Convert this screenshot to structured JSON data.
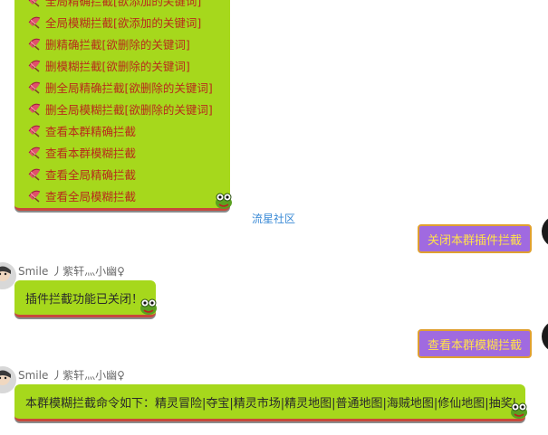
{
  "commands": [
    "全局精确拦截[欲添加的关键词]",
    "全局模糊拦截[欲添加的关键词]",
    "删精确拦截[欲删除的关键词]",
    "删模糊拦截[欲删除的关键词]",
    "删全局精确拦截[欲删除的关键词]",
    "删全局模糊拦截[欲删除的关键词]",
    "查看本群精确拦截",
    "查看本群模糊拦截",
    "查看全局精确拦截",
    "查看全局模糊拦截"
  ],
  "community_link": "流星社区",
  "outgoing": [
    {
      "text": "关闭本群插件拦截"
    },
    {
      "text": "查看本群模糊拦截"
    }
  ],
  "incoming": [
    {
      "sender": "Smile 丿紫轩灬小幽♀",
      "text": "插件拦截功能已关闭！"
    },
    {
      "sender": "Smile 丿紫轩灬小幽♀",
      "text": "本群模糊拦截命令如下：精灵冒险|夺宝|精灵市场|精灵地图|普通地图|海贼地图|修仙地图|抽奖|"
    }
  ],
  "colors": {
    "bubble_green": "#a6d81c",
    "command_text": "#b82b1c",
    "link_blue": "#3a8ad6",
    "bubble_purple": "#a06ae0",
    "purple_text": "#ffe14a"
  }
}
